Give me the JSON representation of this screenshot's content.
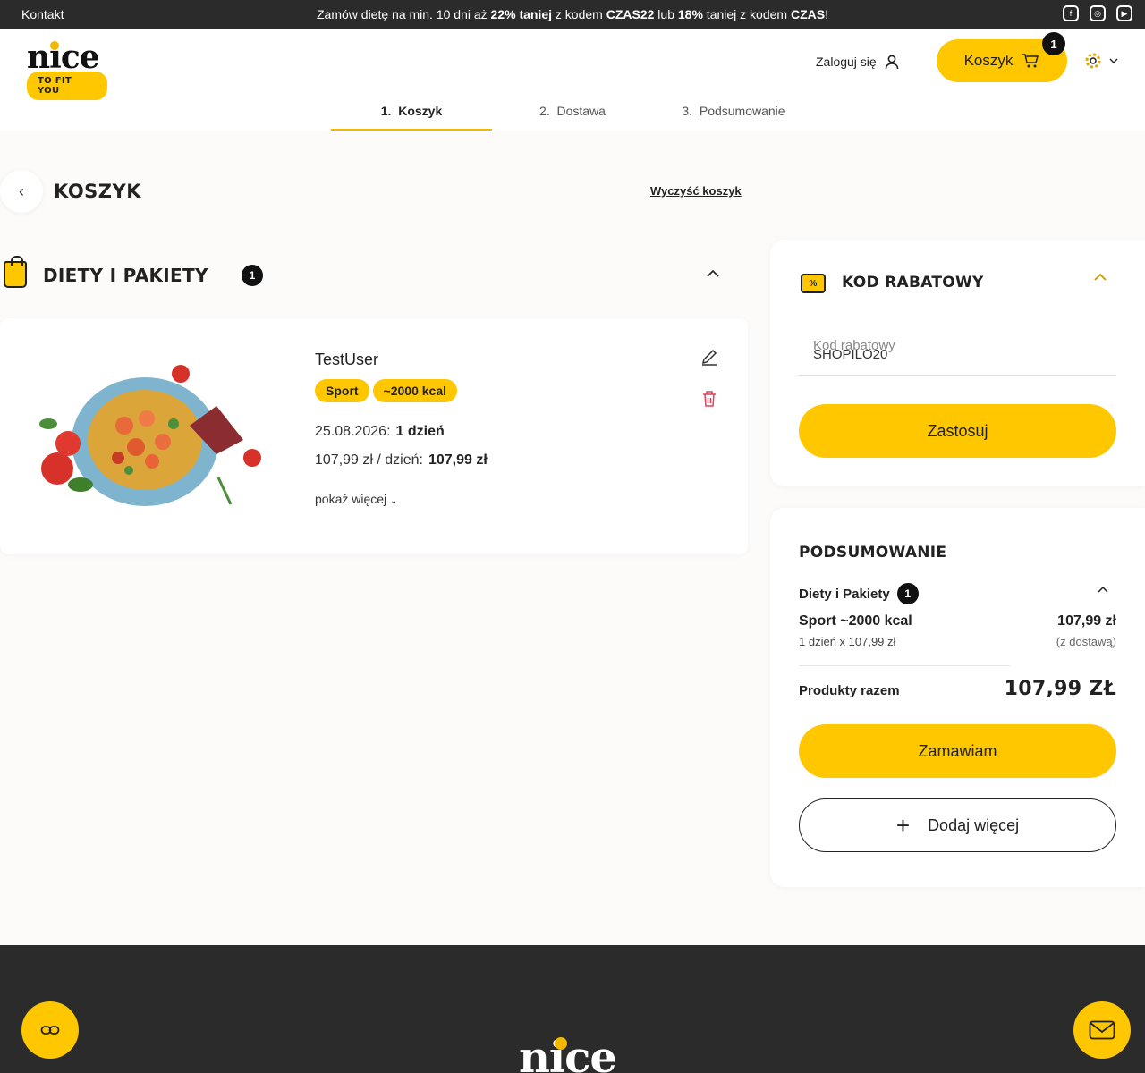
{
  "topbar": {
    "contact": "Kontakt",
    "promo_pre": "Zamów dietę na min. 10 dni aż ",
    "promo_pct1": "22% taniej",
    "promo_mid1": " z kodem ",
    "promo_code1": "CZAS22",
    "promo_mid2": " lub ",
    "promo_pct2": "18%",
    "promo_mid3": " taniej z kodem ",
    "promo_code2": "CZAS",
    "promo_end": "!"
  },
  "header": {
    "logo_word": "nice",
    "logo_tag": "TO FIT YOU",
    "login": "Zaloguj się",
    "cart_label": "Koszyk",
    "cart_count": "1"
  },
  "steps": [
    {
      "num": "1.",
      "label": "Koszyk"
    },
    {
      "num": "2.",
      "label": "Dostawa"
    },
    {
      "num": "3.",
      "label": "Podsumowanie"
    }
  ],
  "page": {
    "title": "KOSZYK",
    "clear": "Wyczyść koszyk"
  },
  "section": {
    "title": "DIETY I PAKIETY",
    "count": "1"
  },
  "item": {
    "name": "TestUser",
    "tag1": "Sport",
    "tag2": "~2000 kcal",
    "date": "25.08.2026:",
    "days": "1 dzień",
    "price_label": "107,99 zł / dzień:",
    "price_value": "107,99 zł",
    "more": "pokaż więcej"
  },
  "discount": {
    "title": "KOD RABATOWY",
    "placeholder": "Kod rabatowy",
    "value": "SHOPILO20",
    "apply": "Zastosuj"
  },
  "summary": {
    "title": "PODSUMOWANIE",
    "group": "Diety i Pakiety",
    "group_count": "1",
    "line_name": "Sport ~2000 kcal",
    "line_sub": "1 dzień x 107,99 zł",
    "line_price": "107,99 zł",
    "line_note": "(z dostawą)",
    "total_label": "Produkty razem",
    "total_value": "107,99 ZŁ",
    "order": "Zamawiam",
    "add_more": "Dodaj więcej"
  },
  "footer": {
    "logo_word": "nice"
  },
  "colors": {
    "accent": "#ffc700",
    "dark": "#2b2b2b"
  }
}
